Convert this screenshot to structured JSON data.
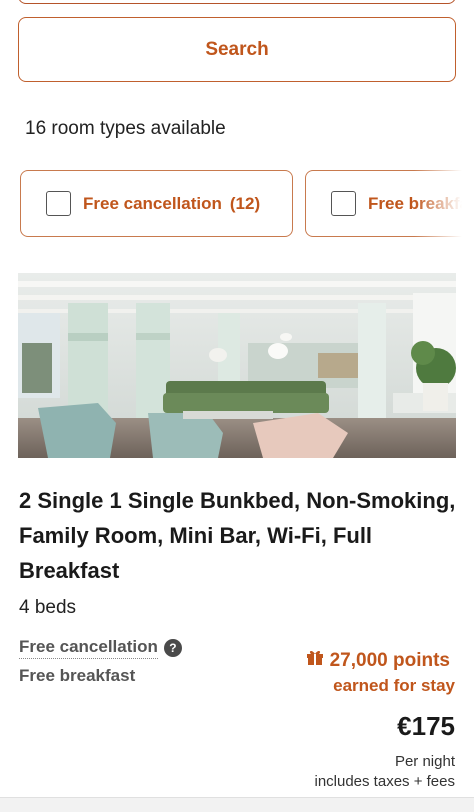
{
  "search": {
    "button_label": "Search"
  },
  "results": {
    "count_text": "16 room types available"
  },
  "filters": [
    {
      "label": "Free cancellation",
      "count": "(12)",
      "checked": false
    },
    {
      "label": "Free breakfast",
      "count": "",
      "checked": false
    }
  ],
  "room": {
    "image_icon": "hotel-lounge-photo",
    "title": "2 Single 1 Single Bunkbed, Non-Smoking, Family Room, Mini Bar, Wi-Fi, Full Breakfast",
    "beds": "4 beds",
    "perks": {
      "cancellation": "Free cancellation",
      "breakfast": "Free breakfast"
    },
    "points": {
      "value": "27,000 points",
      "suffix": "earned for stay",
      "icon": "gift-icon"
    },
    "price": {
      "amount": "€175",
      "per": "Per night",
      "note": "includes taxes + fees"
    }
  },
  "colors": {
    "accent": "#c0561c",
    "border": "#c87a4e",
    "text": "#1a1a1a"
  }
}
